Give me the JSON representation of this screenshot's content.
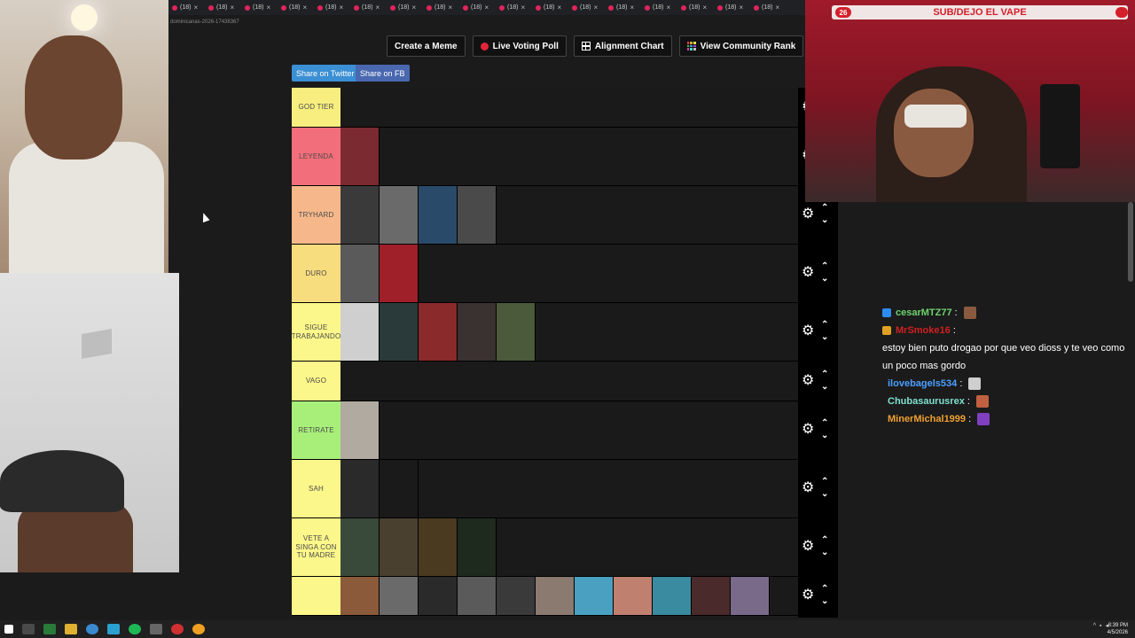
{
  "browser": {
    "tab_label": "(18)",
    "tab_count": 17,
    "url_fragment": "dominicanas-2026-17438367"
  },
  "toolbar": {
    "create_meme": "Create a Meme",
    "live_voting": "Live Voting Poll",
    "alignment_chart": "Alignment Chart",
    "community_rank": "View Community Rank",
    "share_twitter": "Share on Twitter",
    "share_fb": "Share on FB"
  },
  "tiers": [
    {
      "label": "GOD TIER",
      "color": "#f7ee7f",
      "thumbs": []
    },
    {
      "label": "LEYENDA",
      "color": "#f26e7a",
      "thumbs": [
        "#7a2a30"
      ]
    },
    {
      "label": "TRYHARD",
      "color": "#f6b88a",
      "thumbs": [
        "#3a3a3a",
        "#6a6a6a",
        "#2a4a6a",
        "#4a4a4a"
      ]
    },
    {
      "label": "DURO",
      "color": "#f8dd7f",
      "thumbs": [
        "#5a5a5a",
        "#a0202a"
      ]
    },
    {
      "label": "SIGUE TRABAJANDO",
      "color": "#fcf78a",
      "thumbs": [
        "#cfcfcf",
        "#2a3a3a",
        "#8a2a2a",
        "#3a3230",
        "#4a5a3a"
      ]
    },
    {
      "label": "VAGO",
      "color": "#fcf78a",
      "thumbs": []
    },
    {
      "label": "RETIRATE",
      "color": "#a8ef7a",
      "thumbs": [
        "#b0aaa0"
      ]
    },
    {
      "label": "SAH",
      "color": "#fcf78a",
      "thumbs": [
        "#2a2a2a",
        "#1a1a1a"
      ]
    },
    {
      "label": "VETE A SINGA CON TU MADRE",
      "color": "#fcf78a",
      "thumbs": [
        "#3a4a3a",
        "#4a4030",
        "#4a3a20",
        "#1f2a1f"
      ]
    },
    {
      "label": "",
      "color": "#fcf78a",
      "thumbs": [
        "#8a5a3a",
        "#6a6a6a",
        "#2a2a2a",
        "#5a5a5a",
        "#3a3a3a",
        "#8a7a70",
        "#4aa0c0",
        "#c08070",
        "#3a8aa0",
        "#4a2a2a",
        "#7a6a8a"
      ]
    }
  ],
  "stream": {
    "banner_text": "SUB/DEJO EL VAPE",
    "badge_count": "26"
  },
  "chat": [
    {
      "user": "cesarMTZ77",
      "color": "#6ed36e",
      "icon_color": "#2d8cf0",
      "text": "",
      "emote": "#8a5a40"
    },
    {
      "user": "MrSmoke16",
      "color": "#d02020",
      "icon_color": "#e0a020",
      "text": "estoy bien puto drogao por que veo dioss y te veo como un poco mas gordo",
      "emote": ""
    },
    {
      "user": "ilovebagels534",
      "color": "#4aa0ff",
      "icon_color": "",
      "text": "",
      "emote": "#cfcfcf"
    },
    {
      "user": "Chubasaurusrex",
      "color": "#7fe0d0",
      "icon_color": "",
      "text": "",
      "emote": "#c06040"
    },
    {
      "user": "MinerMichal1999",
      "color": "#f0a030",
      "icon_color": "",
      "text": "",
      "emote": "#8040c0"
    }
  ],
  "taskbar": {
    "time": "8:39 PM",
    "date": "4/5/2026"
  }
}
